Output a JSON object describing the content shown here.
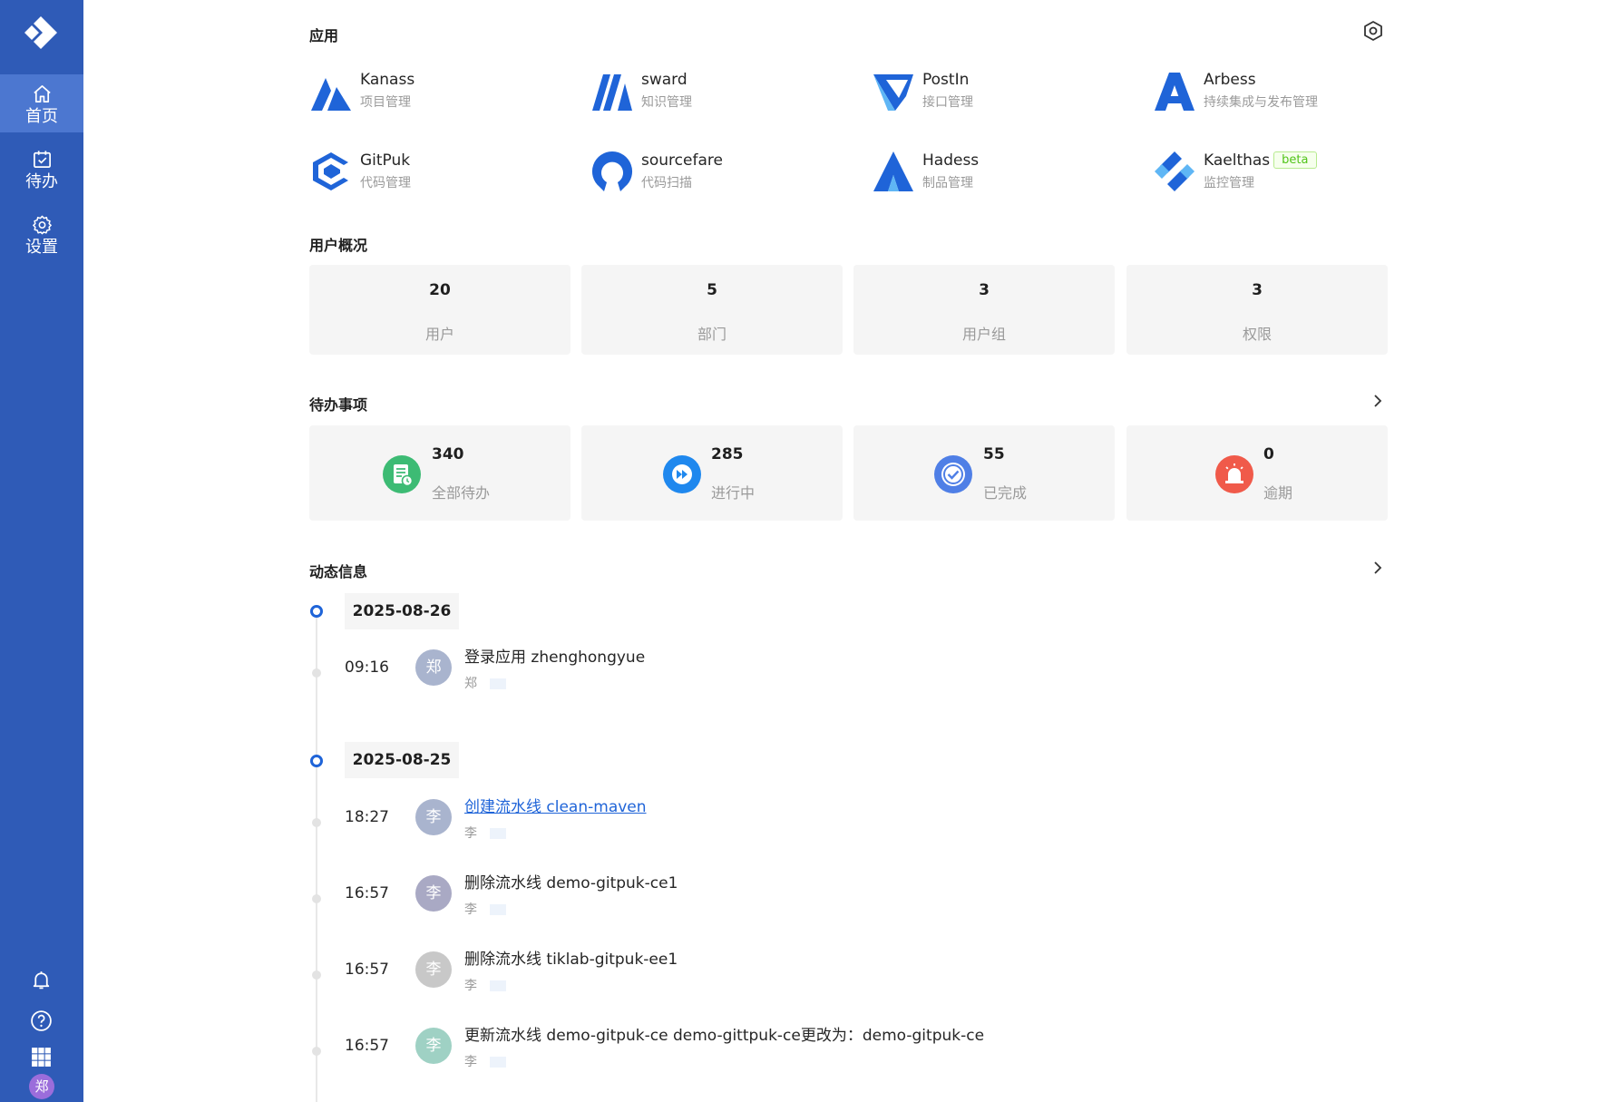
{
  "sidebar": {
    "items": [
      {
        "label": "首页",
        "icon": "home-icon",
        "active": true
      },
      {
        "label": "待办",
        "icon": "calendar-check-icon",
        "active": false
      },
      {
        "label": "设置",
        "icon": "gear-icon",
        "active": false
      }
    ],
    "footer_icons": [
      "bell-icon",
      "help-icon",
      "apps-grid-icon"
    ],
    "avatar": "郑",
    "colors": {
      "background": "#2f5bb7",
      "active": "#4c77d0"
    }
  },
  "apps": {
    "title": "应用",
    "items": [
      {
        "name": "Kanass",
        "desc": "项目管理",
        "icon": "kanass-logo-icon"
      },
      {
        "name": "sward",
        "desc": "知识管理",
        "icon": "sward-logo-icon"
      },
      {
        "name": "PostIn",
        "desc": "接口管理",
        "icon": "postin-logo-icon"
      },
      {
        "name": "Arbess",
        "desc": "持续集成与发布管理",
        "icon": "arbess-logo-icon"
      },
      {
        "name": "GitPuk",
        "desc": "代码管理",
        "icon": "gitpuk-logo-icon"
      },
      {
        "name": "sourcefare",
        "desc": "代码扫描",
        "icon": "sourcefare-logo-icon"
      },
      {
        "name": "Hadess",
        "desc": "制品管理",
        "icon": "hadess-logo-icon"
      },
      {
        "name": "Kaelthas",
        "desc": "监控管理",
        "icon": "kaelthas-logo-icon",
        "badge": "beta"
      }
    ]
  },
  "users": {
    "title": "用户概况",
    "stats": [
      {
        "value": "20",
        "label": "用户"
      },
      {
        "value": "5",
        "label": "部门"
      },
      {
        "value": "3",
        "label": "用户组"
      },
      {
        "value": "3",
        "label": "权限"
      }
    ]
  },
  "todos": {
    "title": "待办事项",
    "items": [
      {
        "value": "340",
        "label": "全部待办",
        "color": "#3dbb74"
      },
      {
        "value": "285",
        "label": "进行中",
        "color": "#1f88ee"
      },
      {
        "value": "55",
        "label": "已完成",
        "color": "#4f7fe6"
      },
      {
        "value": "0",
        "label": "逾期",
        "color": "#f05a4a"
      }
    ]
  },
  "activity": {
    "title": "动态信息",
    "groups": [
      {
        "date": "2025-08-26",
        "entries": [
          {
            "time": "09:16",
            "avatar": "郑",
            "text": "登录应用 zhenghongyue",
            "user": "郑",
            "link": false,
            "avatar_color": "#a9b4ce"
          }
        ]
      },
      {
        "date": "2025-08-25",
        "entries": [
          {
            "time": "18:27",
            "avatar": "李",
            "text": "创建流水线 clean-maven",
            "user": "李",
            "link": true,
            "avatar_color": "#a9b4ce"
          },
          {
            "time": "16:57",
            "avatar": "李",
            "text": "删除流水线 demo-gitpuk-ce1",
            "user": "李",
            "link": false,
            "avatar_color": "#a9a9c4"
          },
          {
            "time": "16:57",
            "avatar": "李",
            "text": "删除流水线 tiklab-gitpuk-ee1",
            "user": "李",
            "link": false,
            "avatar_color": "#c8c8c8"
          },
          {
            "time": "16:57",
            "avatar": "李",
            "text": "更新流水线 demo-gitpuk-ce demo-gittpuk-ce更改为：demo-gitpuk-ce",
            "user": "李",
            "link": false,
            "avatar_color": "#9fd1c4"
          }
        ]
      }
    ]
  }
}
